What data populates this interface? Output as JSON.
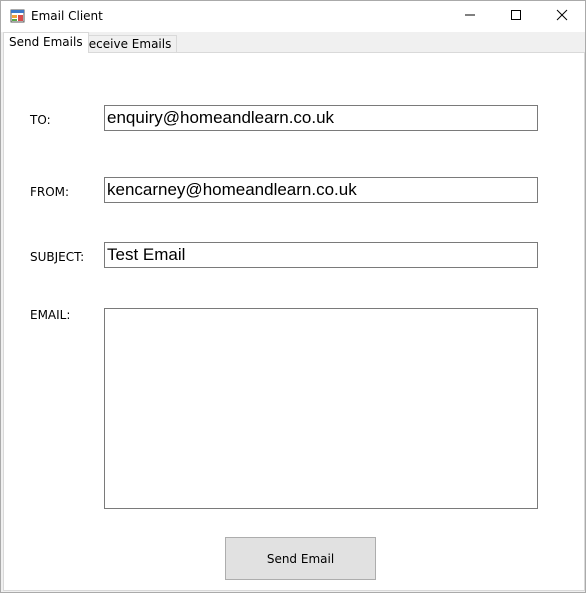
{
  "window": {
    "title": "Email Client",
    "buttons": {
      "minimize": "minimize",
      "maximize": "maximize",
      "close": "close"
    }
  },
  "tabs": [
    {
      "label": "Send Emails",
      "selected": true
    },
    {
      "label": "Receive Emails",
      "selected": false
    }
  ],
  "form": {
    "to_label": "TO:",
    "to_value": "enquiry@homeandlearn.co.uk",
    "from_label": "FROM:",
    "from_value": "kencarney@homeandlearn.co.uk",
    "subject_label": "SUBJECT:",
    "subject_value": "Test Email",
    "email_label": "EMAIL:",
    "email_value": "",
    "send_button": "Send Email"
  },
  "icons": {
    "app": "app-window-icon",
    "minimize": "minimize-icon",
    "maximize": "maximize-icon",
    "close": "close-icon"
  }
}
